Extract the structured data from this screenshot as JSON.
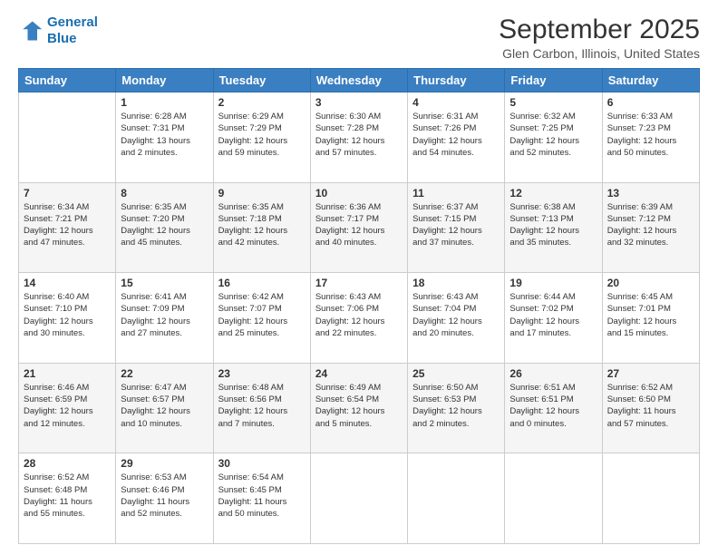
{
  "logo": {
    "line1": "General",
    "line2": "Blue"
  },
  "header": {
    "title": "September 2025",
    "subtitle": "Glen Carbon, Illinois, United States"
  },
  "weekdays": [
    "Sunday",
    "Monday",
    "Tuesday",
    "Wednesday",
    "Thursday",
    "Friday",
    "Saturday"
  ],
  "weeks": [
    [
      {
        "day": "",
        "info": ""
      },
      {
        "day": "1",
        "info": "Sunrise: 6:28 AM\nSunset: 7:31 PM\nDaylight: 13 hours\nand 2 minutes."
      },
      {
        "day": "2",
        "info": "Sunrise: 6:29 AM\nSunset: 7:29 PM\nDaylight: 12 hours\nand 59 minutes."
      },
      {
        "day": "3",
        "info": "Sunrise: 6:30 AM\nSunset: 7:28 PM\nDaylight: 12 hours\nand 57 minutes."
      },
      {
        "day": "4",
        "info": "Sunrise: 6:31 AM\nSunset: 7:26 PM\nDaylight: 12 hours\nand 54 minutes."
      },
      {
        "day": "5",
        "info": "Sunrise: 6:32 AM\nSunset: 7:25 PM\nDaylight: 12 hours\nand 52 minutes."
      },
      {
        "day": "6",
        "info": "Sunrise: 6:33 AM\nSunset: 7:23 PM\nDaylight: 12 hours\nand 50 minutes."
      }
    ],
    [
      {
        "day": "7",
        "info": "Sunrise: 6:34 AM\nSunset: 7:21 PM\nDaylight: 12 hours\nand 47 minutes."
      },
      {
        "day": "8",
        "info": "Sunrise: 6:35 AM\nSunset: 7:20 PM\nDaylight: 12 hours\nand 45 minutes."
      },
      {
        "day": "9",
        "info": "Sunrise: 6:35 AM\nSunset: 7:18 PM\nDaylight: 12 hours\nand 42 minutes."
      },
      {
        "day": "10",
        "info": "Sunrise: 6:36 AM\nSunset: 7:17 PM\nDaylight: 12 hours\nand 40 minutes."
      },
      {
        "day": "11",
        "info": "Sunrise: 6:37 AM\nSunset: 7:15 PM\nDaylight: 12 hours\nand 37 minutes."
      },
      {
        "day": "12",
        "info": "Sunrise: 6:38 AM\nSunset: 7:13 PM\nDaylight: 12 hours\nand 35 minutes."
      },
      {
        "day": "13",
        "info": "Sunrise: 6:39 AM\nSunset: 7:12 PM\nDaylight: 12 hours\nand 32 minutes."
      }
    ],
    [
      {
        "day": "14",
        "info": "Sunrise: 6:40 AM\nSunset: 7:10 PM\nDaylight: 12 hours\nand 30 minutes."
      },
      {
        "day": "15",
        "info": "Sunrise: 6:41 AM\nSunset: 7:09 PM\nDaylight: 12 hours\nand 27 minutes."
      },
      {
        "day": "16",
        "info": "Sunrise: 6:42 AM\nSunset: 7:07 PM\nDaylight: 12 hours\nand 25 minutes."
      },
      {
        "day": "17",
        "info": "Sunrise: 6:43 AM\nSunset: 7:06 PM\nDaylight: 12 hours\nand 22 minutes."
      },
      {
        "day": "18",
        "info": "Sunrise: 6:43 AM\nSunset: 7:04 PM\nDaylight: 12 hours\nand 20 minutes."
      },
      {
        "day": "19",
        "info": "Sunrise: 6:44 AM\nSunset: 7:02 PM\nDaylight: 12 hours\nand 17 minutes."
      },
      {
        "day": "20",
        "info": "Sunrise: 6:45 AM\nSunset: 7:01 PM\nDaylight: 12 hours\nand 15 minutes."
      }
    ],
    [
      {
        "day": "21",
        "info": "Sunrise: 6:46 AM\nSunset: 6:59 PM\nDaylight: 12 hours\nand 12 minutes."
      },
      {
        "day": "22",
        "info": "Sunrise: 6:47 AM\nSunset: 6:57 PM\nDaylight: 12 hours\nand 10 minutes."
      },
      {
        "day": "23",
        "info": "Sunrise: 6:48 AM\nSunset: 6:56 PM\nDaylight: 12 hours\nand 7 minutes."
      },
      {
        "day": "24",
        "info": "Sunrise: 6:49 AM\nSunset: 6:54 PM\nDaylight: 12 hours\nand 5 minutes."
      },
      {
        "day": "25",
        "info": "Sunrise: 6:50 AM\nSunset: 6:53 PM\nDaylight: 12 hours\nand 2 minutes."
      },
      {
        "day": "26",
        "info": "Sunrise: 6:51 AM\nSunset: 6:51 PM\nDaylight: 12 hours\nand 0 minutes."
      },
      {
        "day": "27",
        "info": "Sunrise: 6:52 AM\nSunset: 6:50 PM\nDaylight: 11 hours\nand 57 minutes."
      }
    ],
    [
      {
        "day": "28",
        "info": "Sunrise: 6:52 AM\nSunset: 6:48 PM\nDaylight: 11 hours\nand 55 minutes."
      },
      {
        "day": "29",
        "info": "Sunrise: 6:53 AM\nSunset: 6:46 PM\nDaylight: 11 hours\nand 52 minutes."
      },
      {
        "day": "30",
        "info": "Sunrise: 6:54 AM\nSunset: 6:45 PM\nDaylight: 11 hours\nand 50 minutes."
      },
      {
        "day": "",
        "info": ""
      },
      {
        "day": "",
        "info": ""
      },
      {
        "day": "",
        "info": ""
      },
      {
        "day": "",
        "info": ""
      }
    ]
  ]
}
